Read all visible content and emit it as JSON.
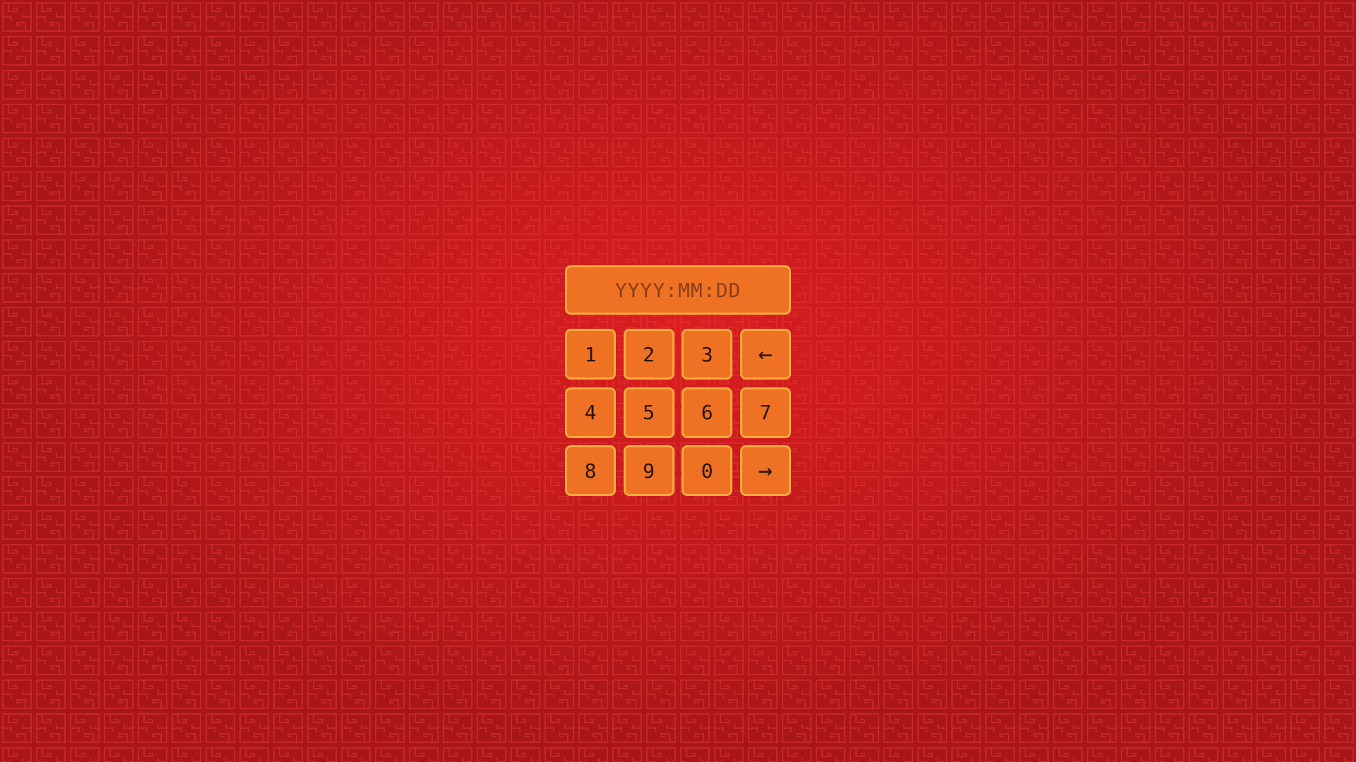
{
  "display": {
    "placeholder": "YYYY:MM:DD",
    "value": ""
  },
  "keys": [
    {
      "label": "1",
      "name": "key-1"
    },
    {
      "label": "2",
      "name": "key-2"
    },
    {
      "label": "3",
      "name": "key-3"
    },
    {
      "label": "←",
      "name": "backspace-arrow-icon"
    },
    {
      "label": "4",
      "name": "key-4"
    },
    {
      "label": "5",
      "name": "key-5"
    },
    {
      "label": "6",
      "name": "key-6"
    },
    {
      "label": "7",
      "name": "key-7"
    },
    {
      "label": "8",
      "name": "key-8"
    },
    {
      "label": "9",
      "name": "key-9"
    },
    {
      "label": "0",
      "name": "key-0"
    },
    {
      "label": "→",
      "name": "submit-arrow-icon"
    }
  ],
  "colors": {
    "background": "#c51a1c",
    "key_fill": "#ee7124",
    "key_border": "#f7a93a",
    "key_text": "#2a1408",
    "placeholder_text": "#8a3e18",
    "pattern_line": "#e03434"
  }
}
